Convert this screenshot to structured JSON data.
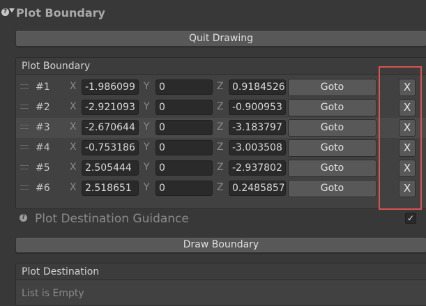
{
  "header": {
    "title": "Plot Boundary",
    "help_glyph": "?"
  },
  "quit_button": {
    "label": "Quit Drawing"
  },
  "boundary_list": {
    "title": "Plot Boundary",
    "axis_labels": {
      "x": "X",
      "y": "Y",
      "z": "Z"
    },
    "goto_label": "Goto",
    "remove_label": "X",
    "rows": [
      {
        "index": "#1",
        "x": "-1.986099",
        "y": "0",
        "z": "0.9184526"
      },
      {
        "index": "#2",
        "x": "-2.921093",
        "y": "0",
        "z": "-0.900953"
      },
      {
        "index": "#3",
        "x": "-2.670644",
        "y": "0",
        "z": "-3.183797"
      },
      {
        "index": "#4",
        "x": "-0.753186",
        "y": "0",
        "z": "-3.003508"
      },
      {
        "index": "#5",
        "x": "2.505444",
        "y": "0",
        "z": "-2.937802"
      },
      {
        "index": "#6",
        "x": "2.518651",
        "y": "0",
        "z": "0.2485857"
      }
    ]
  },
  "guidance": {
    "label": "Plot Destination Guidance",
    "checked": true,
    "check_glyph": "✓",
    "help_glyph": "?"
  },
  "draw_button": {
    "label": "Draw Boundary"
  },
  "destination_list": {
    "title": "Plot Destination",
    "empty_text": "List is Empty"
  },
  "colors": {
    "background": "#383838",
    "highlight": "#d9534f"
  }
}
